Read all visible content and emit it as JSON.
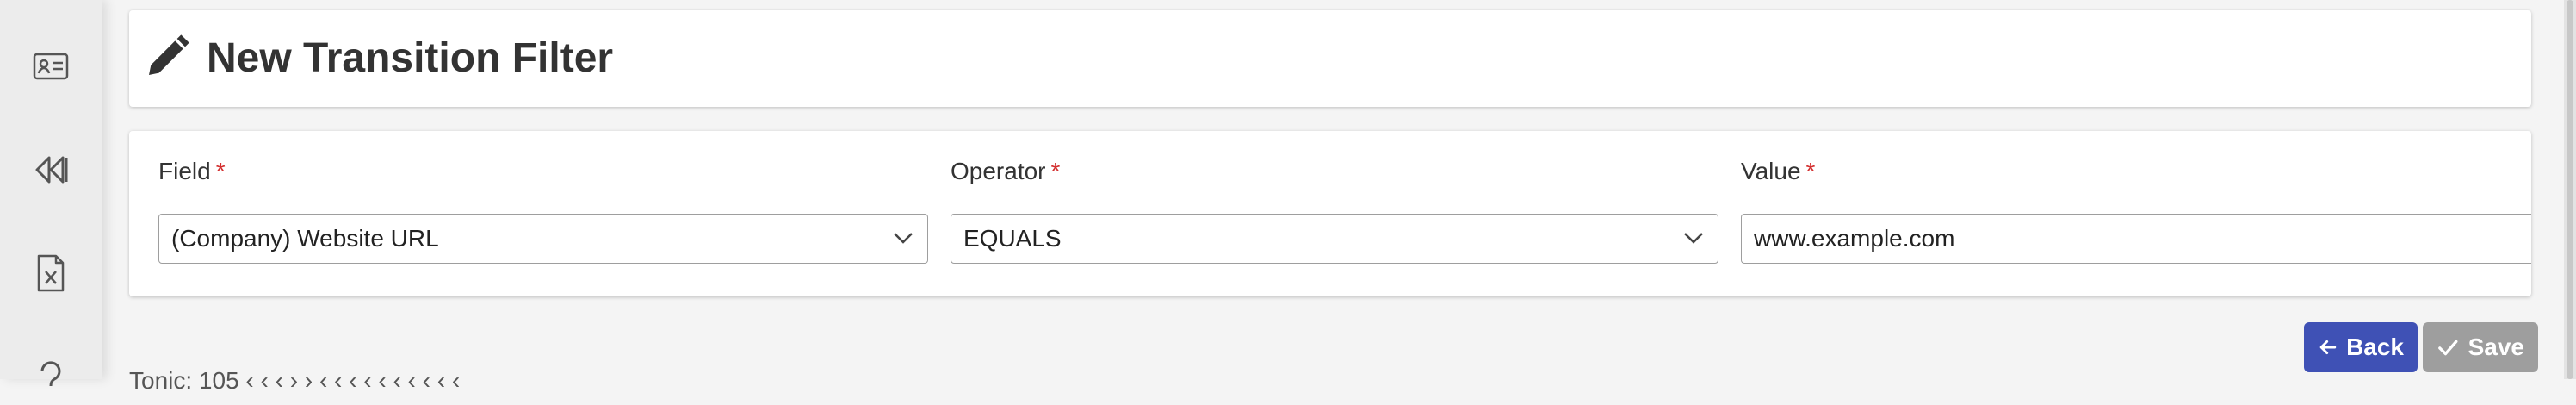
{
  "sidebar": {
    "items": [
      {
        "icon": "contact-card-icon"
      },
      {
        "icon": "rewind-icon"
      },
      {
        "icon": "excel-file-icon"
      },
      {
        "icon": "help-icon"
      }
    ]
  },
  "header": {
    "icon": "pencil-icon",
    "title": "New Transition Filter"
  },
  "form": {
    "field": {
      "label": "Field",
      "required_mark": "*",
      "value": "(Company) Website URL"
    },
    "operator": {
      "label": "Operator",
      "required_mark": "*",
      "value": "EQUALS"
    },
    "value": {
      "label": "Value",
      "required_mark": "*",
      "value": "www.example.com"
    }
  },
  "actions": {
    "back_label": "Back",
    "save_label": "Save"
  },
  "footer": {
    "partial_text": "Tonic: 105 ‹ ‹ ‹ › › ‹ ‹ ‹ ‹ ‹ ‹ ‹ ‹ ‹ ‹"
  },
  "colors": {
    "back_button": "#3f51b5",
    "save_button": "#9e9e9e",
    "required": "#d32f2f"
  }
}
